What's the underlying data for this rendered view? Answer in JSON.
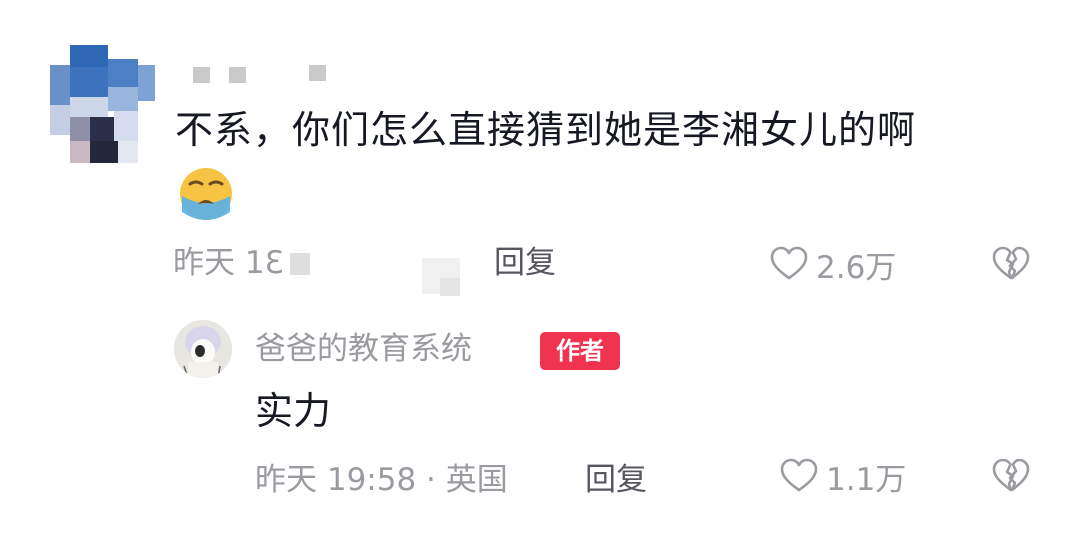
{
  "comment": {
    "text": "不系，你们怎么直接猜到她是李湘女儿的啊",
    "emoji_icon": "loudly-crying-face-icon",
    "time": "昨天 1Ɛ",
    "reply_label": "回复",
    "likes": "2.6万"
  },
  "reply": {
    "author": "爸爸的教育系统",
    "badge": "作者",
    "text": "实力",
    "time": "昨天 19:58 · 英国",
    "reply_label": "回复",
    "likes": "1.1万"
  },
  "colors": {
    "badge": "#f0344f",
    "text_primary": "#161823",
    "text_secondary": "#9a9ba0"
  }
}
